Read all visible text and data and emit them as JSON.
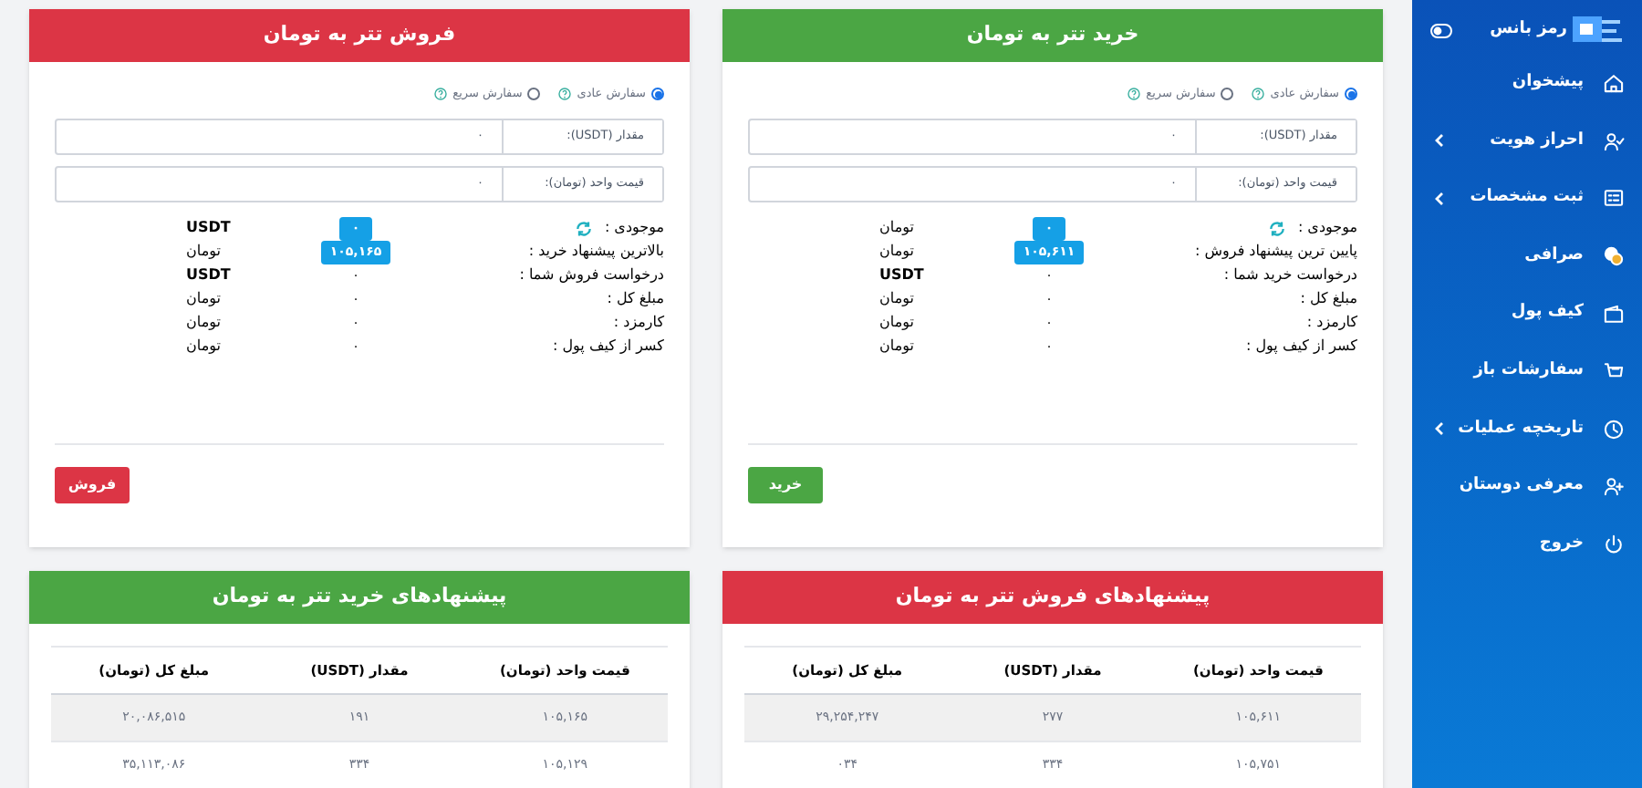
{
  "sidebar": {
    "logo": "رمز بانس",
    "items": [
      {
        "label": "پیشخوان",
        "expandable": false
      },
      {
        "label": "احراز هویت",
        "expandable": true
      },
      {
        "label": "ثبت مشخصات",
        "expandable": true
      },
      {
        "label": "صرافی",
        "expandable": false
      },
      {
        "label": "کیف پول",
        "expandable": false
      },
      {
        "label": "سفارشات باز",
        "expandable": false
      },
      {
        "label": "تاریخچه عملیات",
        "expandable": true
      },
      {
        "label": "معرفی دوستان",
        "expandable": false
      },
      {
        "label": "خروج",
        "expandable": false
      }
    ]
  },
  "order_panels": [
    {
      "kind": "buy",
      "title": "خرید تتر به تومان",
      "order_types": [
        {
          "label": "سفارش عادی",
          "selected": true
        },
        {
          "label": "سفارش سریع",
          "selected": false
        }
      ],
      "fields": [
        {
          "label": "مقدار (USDT):",
          "value": "۰"
        },
        {
          "label": "قیمت واحد (تومان):",
          "value": "۰"
        }
      ],
      "info": [
        {
          "label": "موجودی :",
          "kind": "badge",
          "value": "۰",
          "unit": "تومان"
        },
        {
          "label": "پایین ترین پیشنهاد فروش :",
          "kind": "badge",
          "value": "۱۰۵,۶۱۱",
          "unit": "تومان"
        },
        {
          "label": "درخواست خرید شما :",
          "kind": "plain",
          "value": "۰",
          "unit": "USDT"
        },
        {
          "label": "مبلغ کل :",
          "kind": "plain",
          "value": "۰",
          "unit": "تومان"
        },
        {
          "label": "کارمزد :",
          "kind": "plain",
          "value": "۰",
          "unit": "تومان"
        },
        {
          "label": "کسر از کیف پول :",
          "kind": "plain",
          "value": "۰",
          "unit": "تومان"
        }
      ],
      "button": "خرید"
    },
    {
      "kind": "sell",
      "title": "فروش تتر به تومان",
      "order_types": [
        {
          "label": "سفارش عادی",
          "selected": true
        },
        {
          "label": "سفارش سریع",
          "selected": false
        }
      ],
      "fields": [
        {
          "label": "مقدار (USDT):",
          "value": "۰"
        },
        {
          "label": "قیمت واحد (تومان):",
          "value": "۰"
        }
      ],
      "info": [
        {
          "label": "موجودی :",
          "kind": "badge",
          "value": "۰",
          "unit": "USDT"
        },
        {
          "label": "بالاترین پیشنهاد خرید :",
          "kind": "badge",
          "value": "۱۰۵,۱۶۵",
          "unit": "تومان"
        },
        {
          "label": "درخواست فروش شما :",
          "kind": "plain",
          "value": "۰",
          "unit": "USDT"
        },
        {
          "label": "مبلغ کل :",
          "kind": "plain",
          "value": "۰",
          "unit": "تومان"
        },
        {
          "label": "کارمزد :",
          "kind": "plain",
          "value": "۰",
          "unit": "تومان"
        },
        {
          "label": "کسر از کیف پول :",
          "kind": "plain",
          "value": "۰",
          "unit": "تومان"
        }
      ],
      "button": "فروش"
    }
  ],
  "offer_tables": [
    {
      "kind": "sell",
      "title": "پیشنهادهای فروش تتر به تومان",
      "columns": [
        "قیمت واحد (تومان)",
        "مقدار (USDT)",
        "مبلغ کل (تومان)"
      ],
      "rows": [
        [
          "۱۰۵,۶۱۱",
          "۲۷۷",
          "۲۹,۲۵۴,۲۴۷"
        ],
        [
          "۱۰۵,۷۵۱",
          "۳۳۴",
          "۰۳۴"
        ]
      ]
    },
    {
      "kind": "buy",
      "title": "پیشنهادهای خرید تتر به تومان",
      "columns": [
        "قیمت واحد (تومان)",
        "مقدار (USDT)",
        "مبلغ کل (تومان)"
      ],
      "rows": [
        [
          "۱۰۵,۱۶۵",
          "۱۹۱",
          "۲۰,۰۸۶,۵۱۵"
        ],
        [
          "۱۰۵,۱۲۹",
          "۳۳۴",
          "۳۵,۱۱۳,۰۸۶"
        ]
      ]
    }
  ]
}
